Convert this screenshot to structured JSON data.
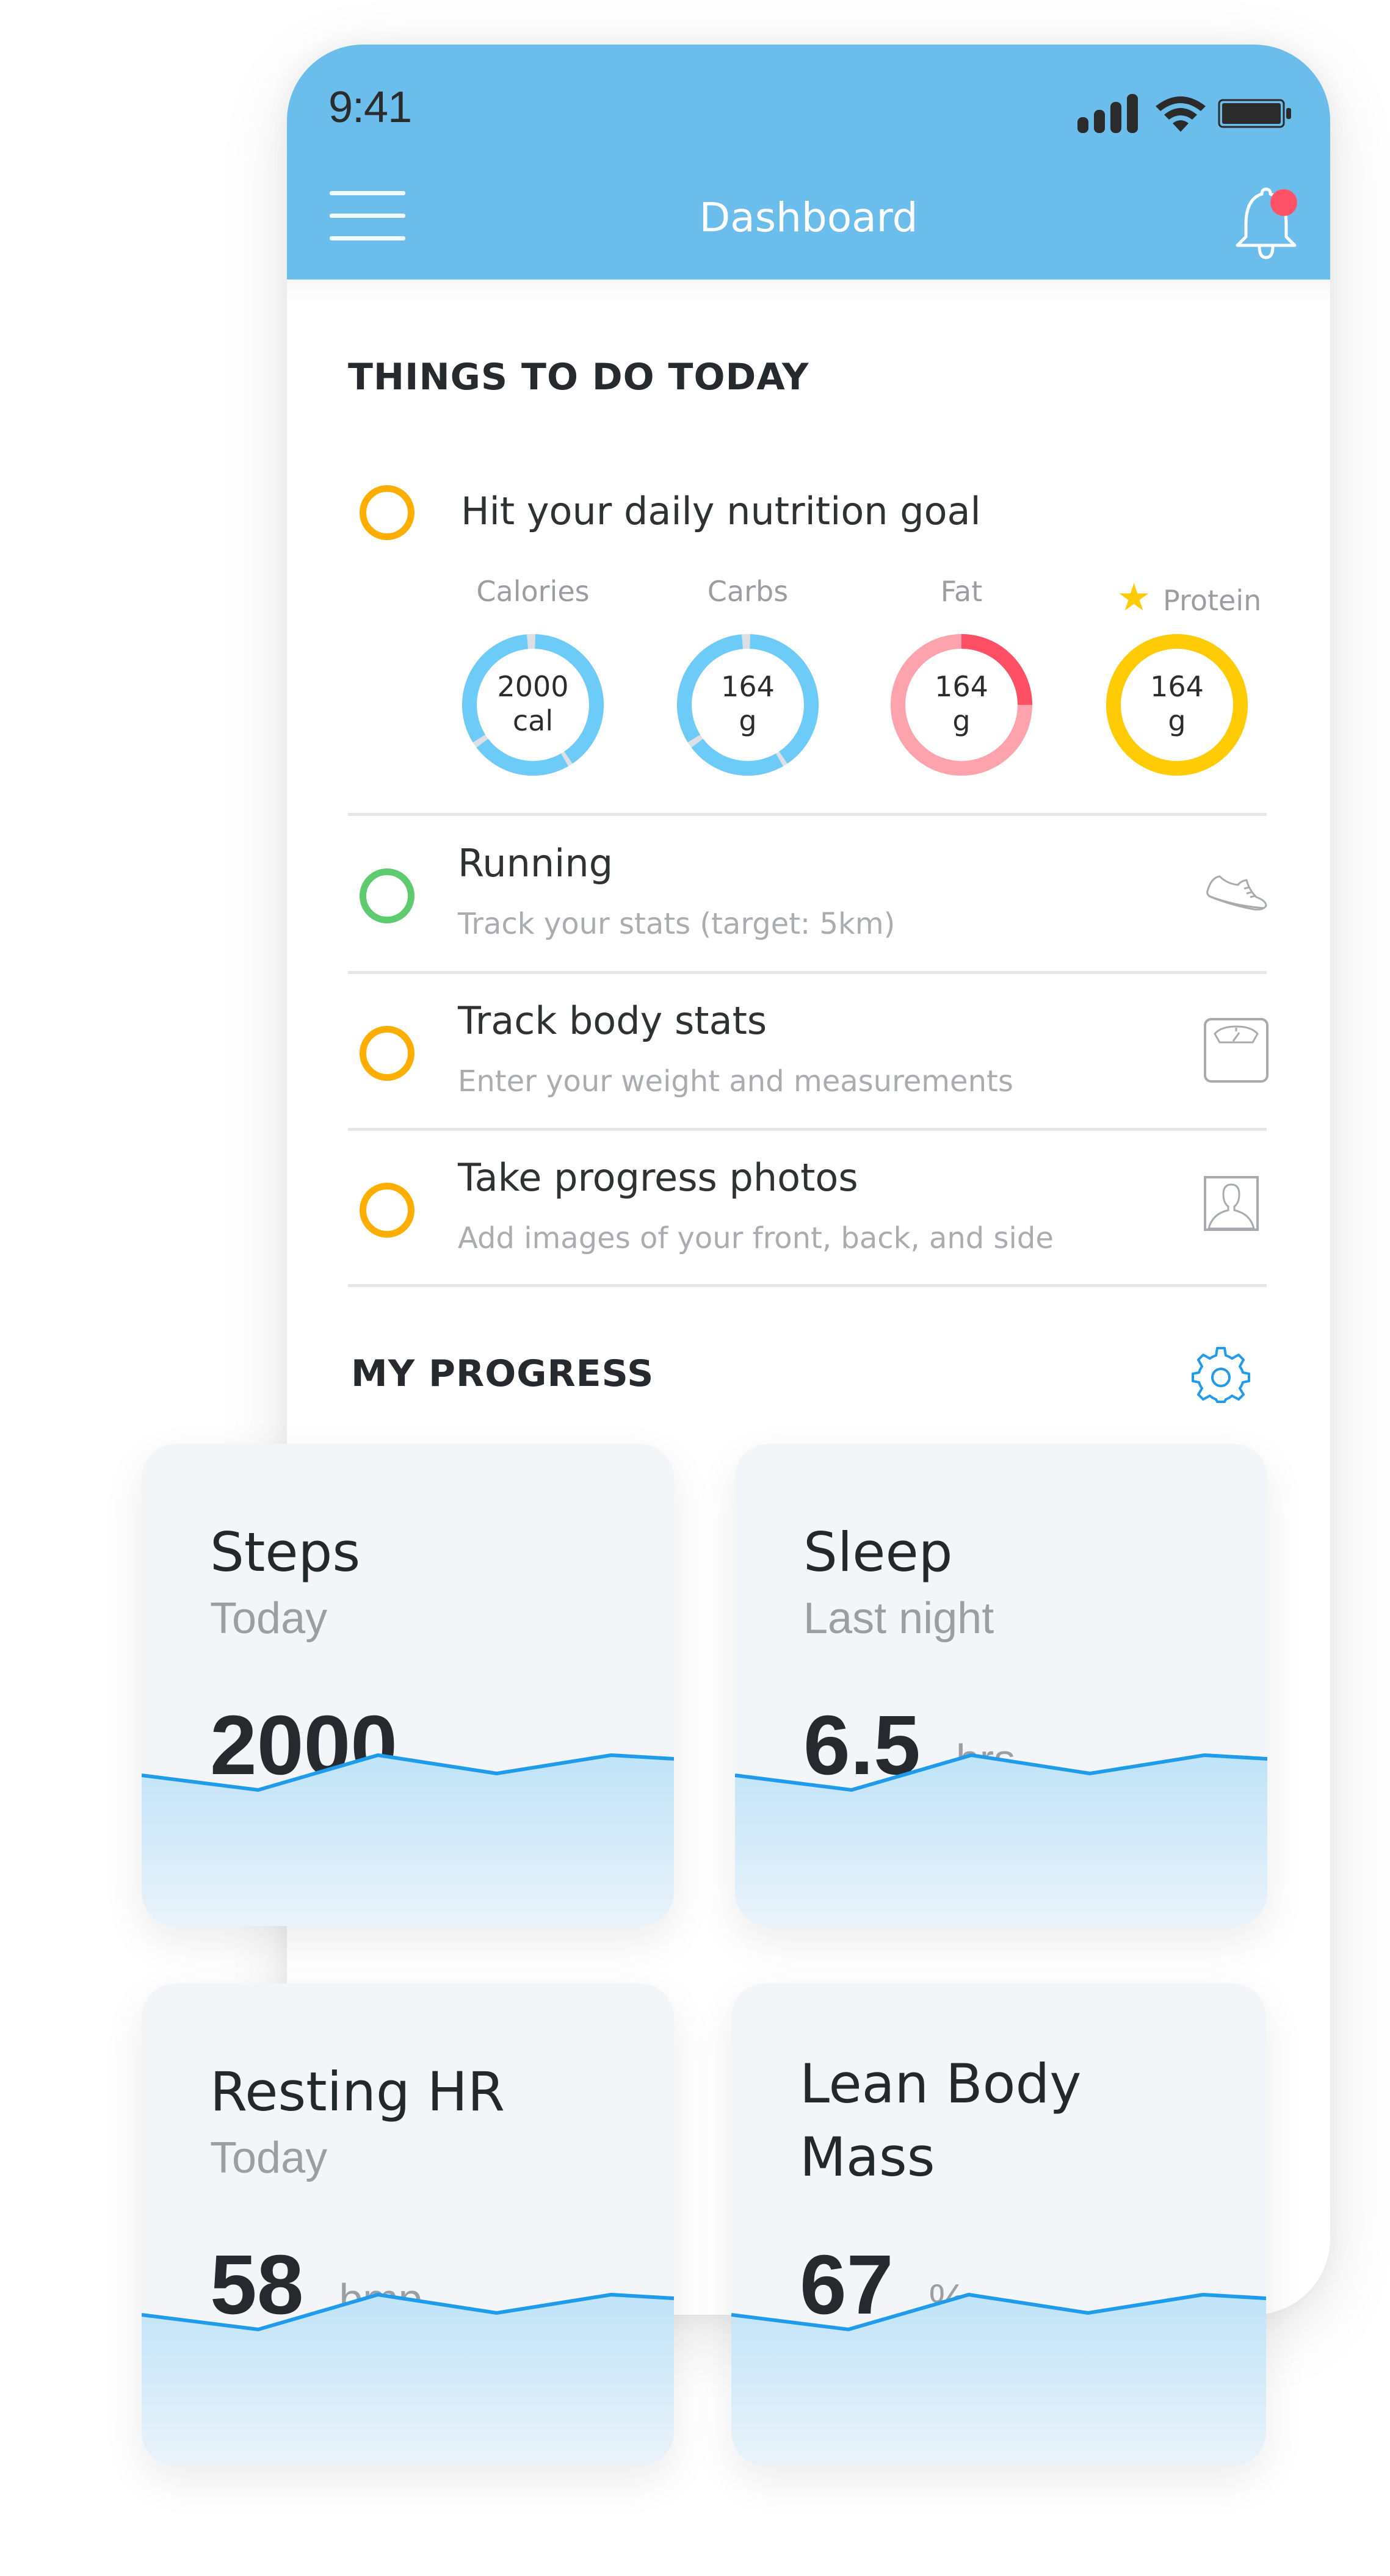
{
  "status_bar": {
    "time": "9:41",
    "icons": [
      "signal-icon",
      "wifi-icon",
      "battery-icon"
    ]
  },
  "header": {
    "title": "Dashboard",
    "menu_icon": "hamburger-menu-icon",
    "notification_icon": "bell-icon",
    "has_notification": true
  },
  "colors": {
    "header": "#6BBEEC",
    "pending": "#FFAE00",
    "complete": "#5ECB6E",
    "calories_carbs": "#6DCBF8",
    "fat_light": "#FDA3AD",
    "fat_dark": "#FF4F64",
    "protein": "#FFCB05",
    "sparkline": "#1E9BEB",
    "accent": "#1E9BEB"
  },
  "todo": {
    "title": "THINGS TO DO TODAY",
    "nutrition": {
      "title": "Hit your daily nutrition goal",
      "status": "pending",
      "macros": [
        {
          "label": "Calories",
          "value": "2000",
          "unit": "cal",
          "starred": false,
          "progress": 1.0,
          "style": "segmented-blue"
        },
        {
          "label": "Carbs",
          "value": "164",
          "unit": "g",
          "starred": false,
          "progress": 1.0,
          "style": "segmented-blue"
        },
        {
          "label": "Fat",
          "value": "164",
          "unit": "g",
          "starred": false,
          "progress": 0.25,
          "style": "red"
        },
        {
          "label": "Protein",
          "value": "164",
          "unit": "g",
          "starred": true,
          "progress": 1.0,
          "style": "yellow"
        }
      ]
    },
    "items": [
      {
        "title": "Running",
        "subtitle": "Track your stats (target: 5km)",
        "status": "complete",
        "icon": "running-shoe-icon"
      },
      {
        "title": "Track body stats",
        "subtitle": "Enter your weight and measurements",
        "status": "pending",
        "icon": "scale-icon"
      },
      {
        "title": "Take progress photos",
        "subtitle": "Add images of your front, back, and side",
        "status": "pending",
        "icon": "photo-portrait-icon"
      }
    ]
  },
  "progress": {
    "title": "MY PROGRESS",
    "settings_icon": "gear-icon",
    "cards": [
      {
        "title": "Steps",
        "subtitle": "Today",
        "value": "2000",
        "unit": "",
        "trend": [
          0.45,
          0.05,
          1.0,
          0.5,
          1.0,
          0.9
        ]
      },
      {
        "title": "Sleep",
        "subtitle": "Last night",
        "value": "6.5",
        "unit": "hrs",
        "trend": [
          0.45,
          0.05,
          1.0,
          0.5,
          1.0,
          0.9
        ]
      },
      {
        "title": "Resting HR",
        "subtitle": "Today",
        "value": "58",
        "unit": "bmp",
        "trend": [
          0.45,
          0.05,
          1.0,
          0.5,
          1.0,
          0.9
        ]
      },
      {
        "title": "Lean Body Mass",
        "subtitle": "",
        "value": "67",
        "unit": "%",
        "trend": [
          0.45,
          0.05,
          1.0,
          0.5,
          1.0,
          0.9
        ]
      }
    ]
  }
}
